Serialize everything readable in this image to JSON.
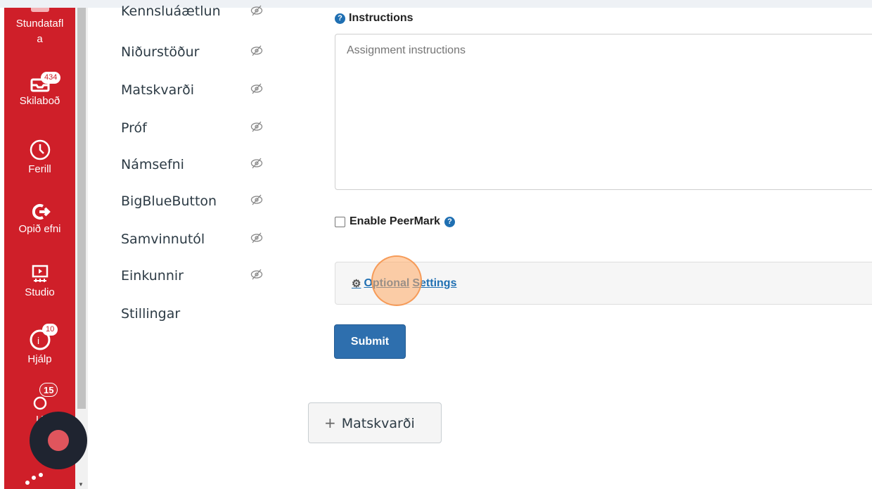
{
  "global_nav": {
    "items": [
      {
        "label": "Stundatafla",
        "icon": "calendar-icon"
      },
      {
        "label": "Skilaboð",
        "icon": "inbox-icon",
        "badge": "434"
      },
      {
        "label": "Ferill",
        "icon": "clock-icon"
      },
      {
        "label": "Opið efni",
        "icon": "commons-icon"
      },
      {
        "label": "Studio",
        "icon": "studio-icon"
      },
      {
        "label": "Hjálp",
        "icon": "help-icon",
        "badge": "10"
      },
      {
        "label": "U",
        "icon": "user-icon",
        "badge": "15"
      }
    ],
    "stundatafla_line1": "Stundatafl",
    "stundatafla_line2": "a",
    "colors": {
      "background": "#cf1f29",
      "text": "#ffffff"
    }
  },
  "course_nav": {
    "items": [
      {
        "label": "Kennsluáætlun"
      },
      {
        "label": "Niðurstöður"
      },
      {
        "label": "Matskvarði"
      },
      {
        "label": "Próf"
      },
      {
        "label": "Námsefni"
      },
      {
        "label": "BigBlueButton"
      },
      {
        "label": "Samvinnutól"
      },
      {
        "label": "Einkunnir"
      },
      {
        "label": "Stillingar"
      }
    ],
    "hidden_icon": "eye-slash-icon"
  },
  "form": {
    "instructions_label": "Instructions",
    "instructions_placeholder": "Assignment instructions",
    "peermark_label": "Enable PeerMark",
    "optional_settings_part1": "Optional",
    "optional_settings_part2": "Settings",
    "submit_label": "Submit",
    "accent_color": "#2e6fae"
  },
  "rubric": {
    "add_label": "Matskvarði"
  }
}
